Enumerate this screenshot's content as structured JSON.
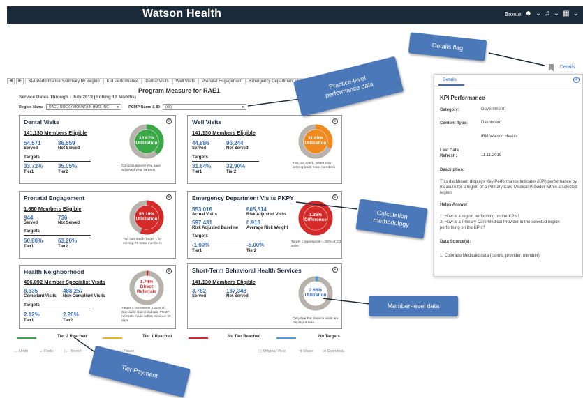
{
  "header": {
    "brand": "Watson Health",
    "user": "Bronte"
  },
  "tabs": [
    "KPI Performance Summary by Region",
    "KPI Performance",
    "Dental Visits",
    "Well Visits",
    "Prenatal Engagement",
    "Emergency Department Visits PKPY"
  ],
  "service_dates": "Service Dates Through - July 2019 (Rolling 12 Months)",
  "page_title": "Program Measure for RAE1",
  "filters": {
    "region_label": "Region Name",
    "region_value": "RAE1: ROCKY MOUNTAIN HMO, INC",
    "pcmp_label": "PCMP Name & ID",
    "pcmp_value": "(All)"
  },
  "cards": {
    "dental": {
      "title": "Dental Visits",
      "eligible": "141,130 Members Eligible",
      "v1": "54,571",
      "l1": "Served",
      "v2": "86,559",
      "l2": "Not Served",
      "targets": "Targets",
      "t1": "33.72%",
      "t1l": "Tier1",
      "t2": "35.05%",
      "t2l": "Tier2",
      "ring_value": "38.67%",
      "ring_label": "Utilization",
      "ring_pct": 38.67,
      "ring_color": "#3aa846",
      "note": "Congratulations! You have achieved your Targets!"
    },
    "well": {
      "title": "Well Visits",
      "eligible": "141,130 Members Eligible",
      "v1": "44,886",
      "l1": "Served",
      "v2": "96,244",
      "l2": "Not Served",
      "targets": "Targets",
      "t1": "31.64%",
      "t1l": "Tier1",
      "t2": "32.90%",
      "t2l": "Tier2",
      "ring_value": "31.80%",
      "ring_label": "Utilization",
      "ring_pct": 31.8,
      "ring_color": "#f08a1e",
      "note": "You can reach Target 2 by serving 1539 more members"
    },
    "prenatal": {
      "title": "Prenatal Engagement",
      "eligible": "1,680 Members Eligible",
      "v1": "944",
      "l1": "Served",
      "v2": "736",
      "l2": "Not Served",
      "targets": "Targets",
      "t1": "60.80%",
      "t1l": "Tier1",
      "t2": "63.20%",
      "t2l": "Tier2",
      "ring_value": "56.19%",
      "ring_label": "Utilization",
      "ring_pct": 56.19,
      "ring_color": "#d62a2a",
      "note": "You can reach Target 1 by serving 78 more members"
    },
    "ed": {
      "title": "Emergency Department Visits PKPY",
      "v1": "553,016",
      "l1": "Actual Visits",
      "v2": "605,514",
      "l2": "Risk Adjusted Visits",
      "v3": "597,431",
      "l3": "Risk Adjusted Baseline",
      "v4": "0.913",
      "l4": "Average Risk Weight",
      "targets": "Targets",
      "t1": "-1.00%",
      "t1l": "Tier1",
      "t2": "-5.00%",
      "t2l": "Tier2",
      "ring_value": "1.35%",
      "ring_label": "Difference",
      "ring_pct": 100,
      "ring_color": "#d62a2a",
      "note": "Target 1 represents -1.00% of ED visits"
    },
    "health": {
      "title": "Health Neighborhood",
      "eligible": "496,892 Member Specialist Visits",
      "v1": "8,635",
      "l1": "Compliant Visits",
      "v2": "488,257",
      "l2": "Non-Compliant Visits",
      "targets": "Targets",
      "t1": "2.12%",
      "t1l": "Tier1",
      "t2": "2.20%",
      "t2l": "Tier2",
      "ring_value": "1.74%",
      "ring_label": "Direct Referrals",
      "ring_pct": 1.74,
      "ring_color": "#d62a2a",
      "note": "Target 1 represents 2.12% of Specialist claims indicate PCMP referrals made within previous 90 days"
    },
    "behavioral": {
      "title": "Short-Term Behavioral Health Services",
      "eligible": "141,130 Members Eligible",
      "v1": "3,782",
      "l1": "Served",
      "v2": "137,348",
      "l2": "Not Served",
      "ring_value": "2.68%",
      "ring_label": "Utilization",
      "ring_pct": 2.68,
      "ring_color": "#4a9bd8",
      "note": "Only Fee For Service visits are displayed here."
    }
  },
  "legend": {
    "tier2": "Tier 2 Reached",
    "tier1": "Tier 1 Reached",
    "none": "No Tier Reached",
    "no_targets": "No Targets",
    "colors": {
      "tier2": "#3aa846",
      "tier1": "#f0b020",
      "none": "#d62a2a",
      "no_targets": "#4a9bd8"
    }
  },
  "footer": {
    "undo": "Undo",
    "redo": "Redo",
    "revert": "Revert",
    "pause": "Pause",
    "original_view": "Original View",
    "share": "Share",
    "download": "Download"
  },
  "details_link": "Details",
  "panel": {
    "tab": "Details",
    "heading": "KPI Performance",
    "category_k": "Category:",
    "category_v": "Government",
    "content_k": "Content Type:",
    "content_v": "Dashboard",
    "owner_v": "IBM Watson Health",
    "refresh_k": "Last Data Refresh:",
    "refresh_v": "11.11.2019",
    "desc_k": "Description:",
    "desc_v": "This dashboard displays Key Performance Indicator (KPI) performance by measure for a region or a Primary Care Medical Provider within a selected region.",
    "helps_k": "Helps Answer:",
    "helps_1": "1. How is a region performing on the KPIs?",
    "helps_2": "2. How is a Primary Care Medical Provider in the selected region performing on the KPIs?",
    "source_k": "Data Source(s):",
    "source_v": "1. Colorado Medicaid data (claims, provider, member)"
  },
  "callouts": {
    "details_flag": "Details flag",
    "practice": "Practice-level performance data",
    "calc": "Calculation methodology",
    "member": "Member-level data",
    "tier": "Tier Payment"
  }
}
